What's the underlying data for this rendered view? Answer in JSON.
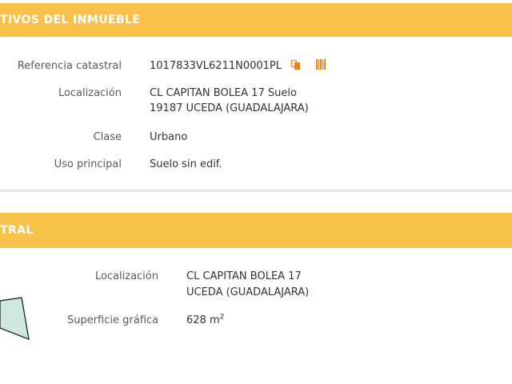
{
  "section_descriptive": {
    "title": "TIVOS DEL INMUEBLE",
    "rows": [
      {
        "label": "Referencia catastral",
        "value": "1017833VL6211N0001PL"
      },
      {
        "label": "Localización",
        "line1": "CL CAPITAN BOLEA 17 Suelo",
        "line2": "19187 UCEDA (GUADALAJARA)"
      },
      {
        "label": "Clase",
        "value": "Urbano"
      },
      {
        "label": "Uso principal",
        "value": "Suelo sin edif."
      }
    ],
    "icons": [
      "copy-icon",
      "barcode-icon"
    ]
  },
  "section_parcel": {
    "title": "TRAL",
    "rows": [
      {
        "label": "Localización",
        "line1": "CL CAPITAN BOLEA 17",
        "line2": "UCEDA (GUADALAJARA)"
      },
      {
        "label": "Superficie gráfica",
        "value": "628 m",
        "unit_sup": "2"
      }
    ]
  },
  "colors": {
    "band": "#f7c14a",
    "icon": "#e9851f",
    "parcel_fill": "#cfe8df"
  }
}
